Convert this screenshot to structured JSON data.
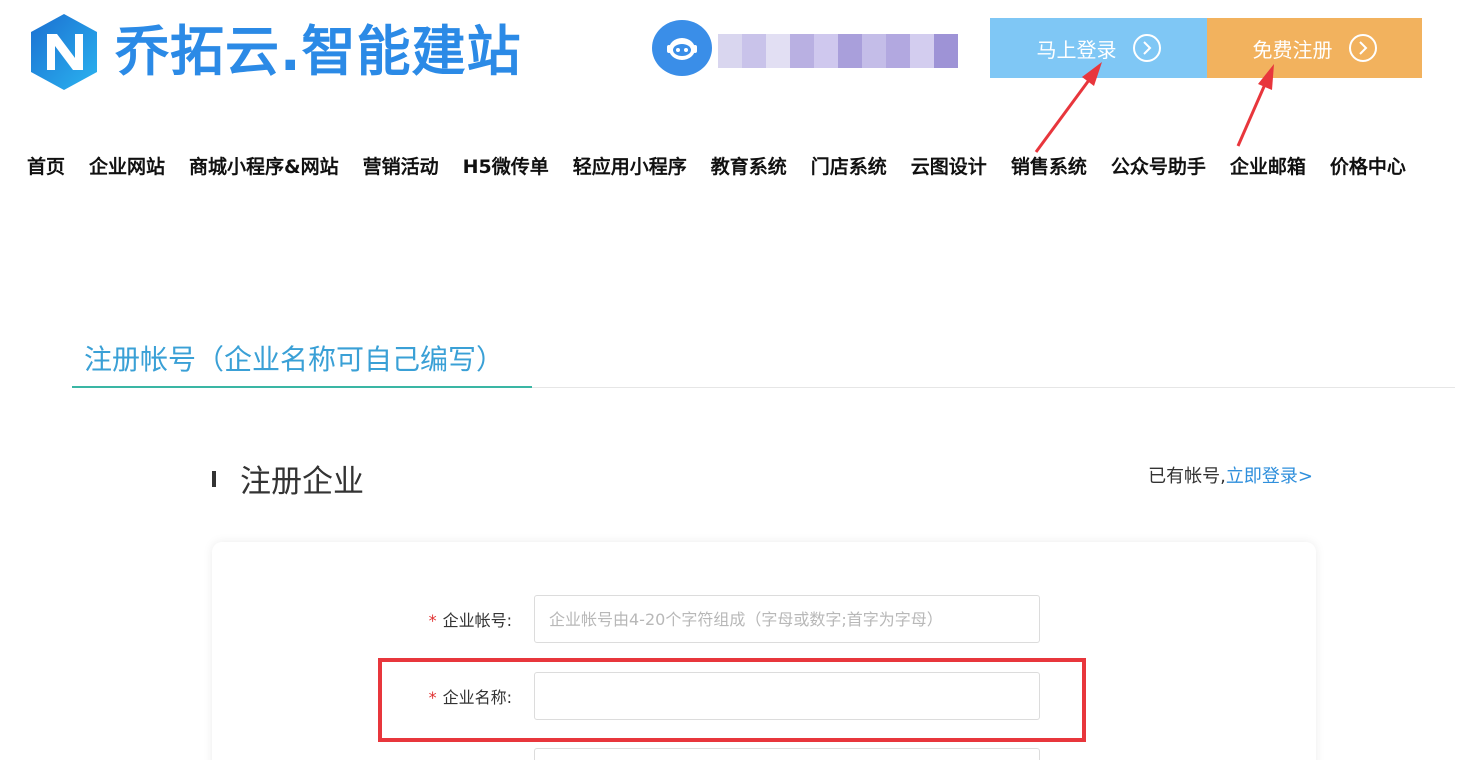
{
  "header": {
    "logo_text": "乔拓云.智能建站",
    "login_button": "马上登录",
    "register_button": "免费注册"
  },
  "nav": {
    "items": [
      "首页",
      "企业网站",
      "商城小程序&网站",
      "营销活动",
      "H5微传单",
      "轻应用小程序",
      "教育系统",
      "门店系统",
      "云图设计",
      "销售系统",
      "公众号助手",
      "企业邮箱",
      "价格中心"
    ]
  },
  "tab": {
    "title": "注册帐号（企业名称可自己编写）"
  },
  "section": {
    "title": "注册企业",
    "have_account_text": "已有帐号,",
    "login_link": "立即登录>"
  },
  "form": {
    "account_label": "企业帐号:",
    "account_placeholder": "企业帐号由4-20个字符组成（字母或数字;首字为字母）",
    "account_value": "",
    "name_label": "企业名称:",
    "name_value": ""
  },
  "colors": {
    "brand_blue": "#2b8ae6",
    "login_bg": "#7fc7f5",
    "register_bg": "#f2b25e",
    "annotation_red": "#e8363c",
    "tab_text": "#3aa0d6",
    "link": "#2f8fdc"
  }
}
